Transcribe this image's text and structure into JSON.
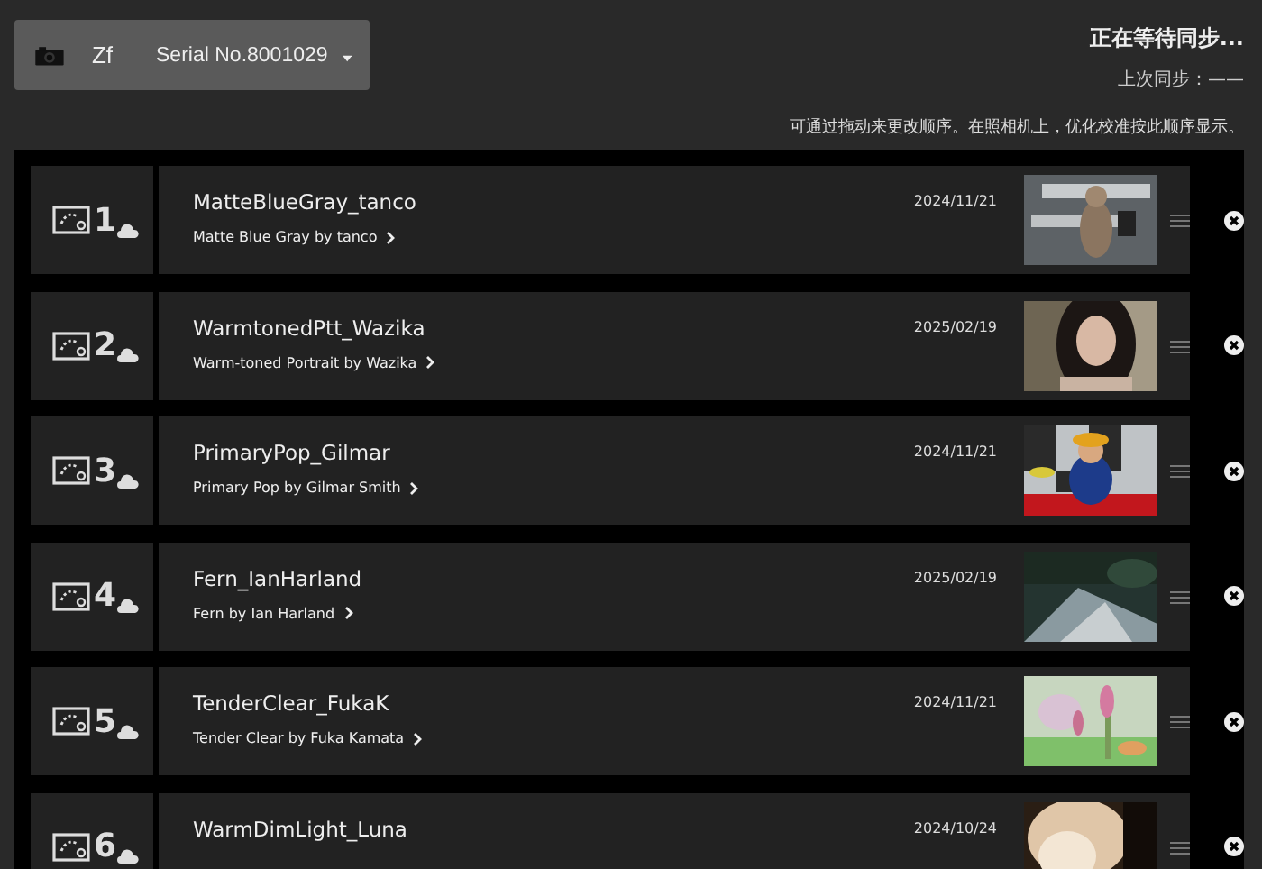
{
  "camera": {
    "model": "Zf",
    "serial": "Serial No.8001029"
  },
  "sync": {
    "status": "正在等待同步...",
    "last": "上次同步：——"
  },
  "hint": "可通过拖动来更改顺序。在照相机上，优化校准按此顺序显示。",
  "presets": [
    {
      "number": "1",
      "name": "MatteBlueGray_tanco",
      "subtitle": "Matte Blue Gray by tanco",
      "date": "2024/11/21"
    },
    {
      "number": "2",
      "name": "WarmtonedPtt_Wazika",
      "subtitle": "Warm-toned Portrait by Wazika",
      "date": "2025/02/19"
    },
    {
      "number": "3",
      "name": "PrimaryPop_Gilmar",
      "subtitle": "Primary Pop by Gilmar Smith",
      "date": "2024/11/21"
    },
    {
      "number": "4",
      "name": "Fern_IanHarland",
      "subtitle": "Fern by Ian Harland",
      "date": "2025/02/19"
    },
    {
      "number": "5",
      "name": "TenderClear_FukaK",
      "subtitle": "Tender Clear by Fuka Kamata",
      "date": "2024/11/21"
    },
    {
      "number": "6",
      "name": "WarmDimLight_Luna",
      "date": "2024/10/24"
    }
  ]
}
